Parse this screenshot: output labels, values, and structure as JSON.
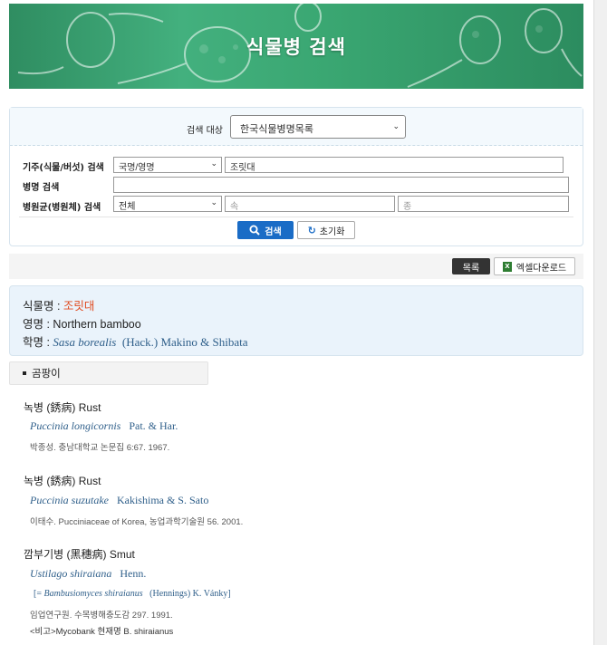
{
  "banner": {
    "title": "식물병 검색"
  },
  "search": {
    "target_label": "검색 대상",
    "target_value": "한국식물병명목록",
    "host_label": "기주(식물/버섯) 검색",
    "host_type": "국명/영명",
    "host_value": "조릿대",
    "disease_label": "병명 검색",
    "disease_value": "",
    "pathogen_label": "병원균(병원체) 검색",
    "pathogen_type": "전체",
    "genus_placeholder": "속",
    "species_placeholder": "종",
    "search_button": "검색",
    "reset_button": "초기화"
  },
  "toolbar": {
    "list_button": "목록",
    "excel_button": "엑셀다운로드"
  },
  "plant": {
    "name_label": "식물명 : ",
    "name": "조릿대",
    "english_label": "영명 : ",
    "english": "Northern bamboo",
    "sci_label": "학명 : ",
    "sci_genus_species": "Sasa borealis",
    "sci_author": "(Hack.) Makino & Shibata"
  },
  "category": "곰팡이",
  "entries": [
    {
      "title": "녹병 (銹病) Rust",
      "pathogen": "Puccinia longicornis",
      "author": "Pat. & Har.",
      "reference": "박종성. 충남대학교 논문집 6:67. 1967."
    },
    {
      "title": "녹병 (銹病) Rust",
      "pathogen": "Puccinia suzutake",
      "author": "Kakishima & S. Sato",
      "reference": "이태수. Pucciniaceae of Korea, 농업과학기술원 56. 2001."
    },
    {
      "title": "깜부기병 (黑穗病) Smut",
      "pathogen": "Ustilago shiraiana",
      "author": "Henn.",
      "synonym_open": "[= ",
      "synonym": "Bambusiomyces shiraianus",
      "synonym_author": "(Hennings) K. Vánky]",
      "reference": "임업연구원. 수목병해충도감 297. 1991.",
      "note": "<비고>Mycobank 현재명 B. shiraianus"
    }
  ],
  "colors": {
    "accent_blue": "#1a6cc6",
    "sci_blue": "#2f5f8a",
    "plant_red": "#e04a1e",
    "banner_green": "#3aa772"
  }
}
